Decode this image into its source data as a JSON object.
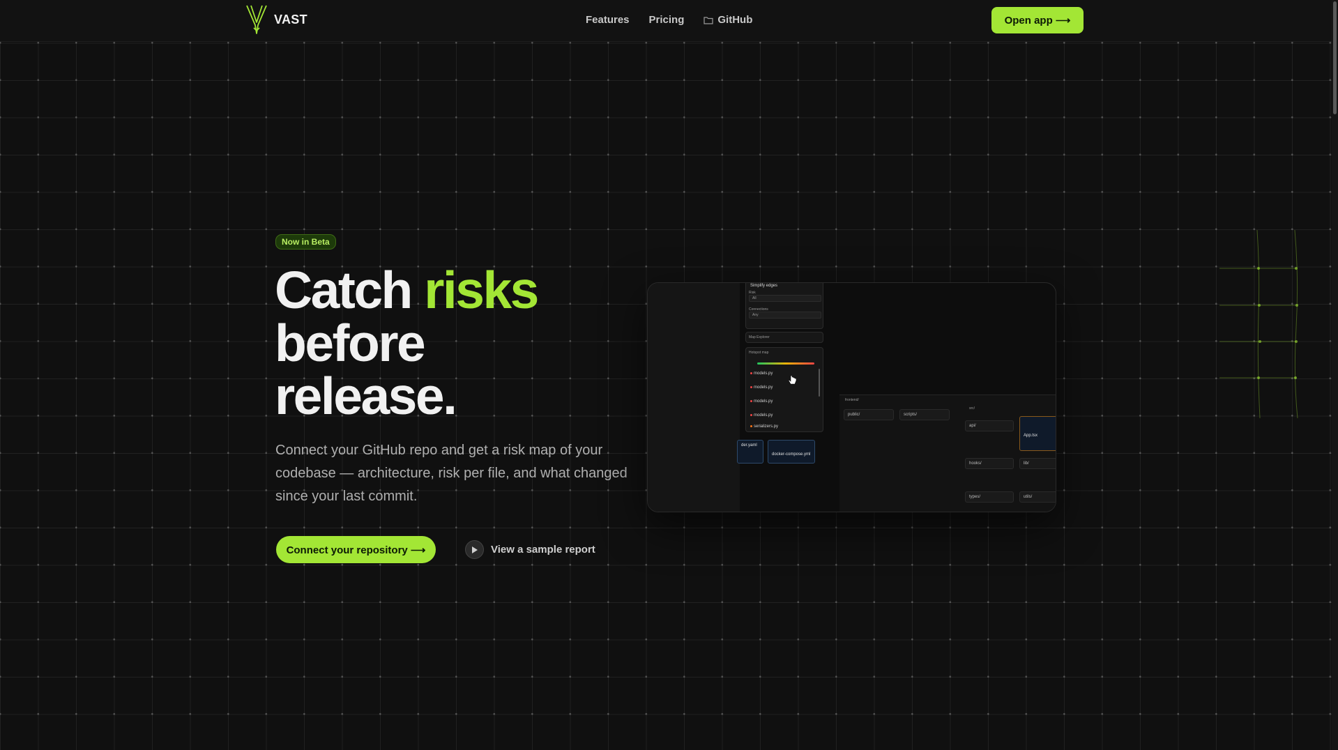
{
  "brand": {
    "name": "VAST",
    "accent": "#a3e635"
  },
  "nav": {
    "links": [
      "Features",
      "Pricing",
      "GitHub"
    ],
    "cta": "Open app ⟶"
  },
  "hero": {
    "badge": "Now in Beta",
    "headline_1": "Catch ",
    "headline_accent": "risks",
    "headline_2": "before",
    "headline_3": "release.",
    "subtext": "Connect your GitHub repo and get a risk map of your codebase — architecture, risk per file, and what changed since your last commit.",
    "primary_cta": "Connect your repository ⟶",
    "secondary_cta": "View a sample report"
  },
  "preview": {
    "simplify_label": "Simplify edges",
    "risk_label": "Risk",
    "risk_value": "All",
    "connections_label": "Connections",
    "connections_value": "Any",
    "map_explorer": "Map Explorer",
    "hotspot_map": "Hotspot map",
    "hotspot_files": [
      "models.py",
      "models.py",
      "models.py",
      "models.py",
      "serializers.py"
    ],
    "tree": {
      "frontend": "frontend/",
      "public": "public/",
      "scripts": "scripts/",
      "src": "src/",
      "api": "api/",
      "hooks": "hooks/",
      "lib": "lib/",
      "types": "types/",
      "utils": "utils/",
      "app": "App.tsx",
      "yaml_1": "der.yaml",
      "yaml_2": "docker-compose.yml"
    }
  },
  "icons": [
    "logo-icon",
    "folder-icon",
    "play-icon",
    "cursor-icon"
  ]
}
